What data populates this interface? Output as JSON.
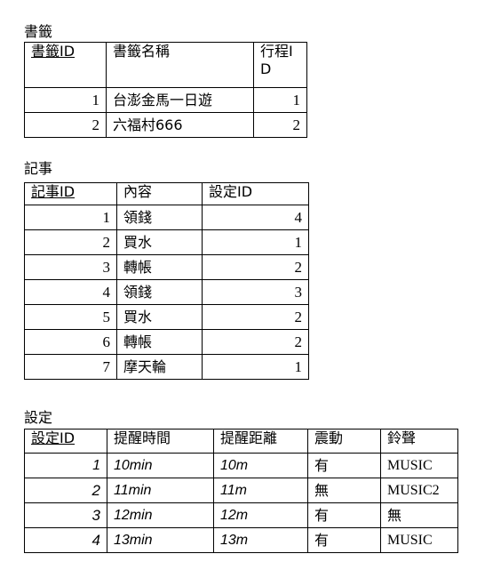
{
  "bookmarks": {
    "title": "書籤",
    "headers": [
      "書籤ID",
      "書籤名稱",
      "行程ID"
    ],
    "rows": [
      [
        "1",
        "台澎金馬一日遊",
        "1"
      ],
      [
        "2",
        "六福村666",
        "2"
      ]
    ]
  },
  "notes": {
    "title": "記事",
    "headers": [
      "記事ID",
      "內容",
      "設定ID"
    ],
    "rows": [
      [
        "1",
        "領錢",
        "4"
      ],
      [
        "2",
        "買水",
        "1"
      ],
      [
        "3",
        "轉帳",
        "2"
      ],
      [
        "4",
        "領錢",
        "3"
      ],
      [
        "5",
        "買水",
        "2"
      ],
      [
        "6",
        "轉帳",
        "2"
      ],
      [
        "7",
        "摩天輪",
        "1"
      ]
    ]
  },
  "settings": {
    "title": "設定",
    "headers": [
      "設定ID",
      "提醒時間",
      "提醒距離",
      "震動",
      "鈴聲"
    ],
    "rows": [
      [
        "1",
        "10min",
        "10m",
        "有",
        "MUSIC"
      ],
      [
        "2",
        "11min",
        "11m",
        "無",
        "MUSIC2"
      ],
      [
        "3",
        "12min",
        "12m",
        "有",
        "無"
      ],
      [
        "4",
        "13min",
        "13m",
        "有",
        "MUSIC"
      ]
    ]
  }
}
